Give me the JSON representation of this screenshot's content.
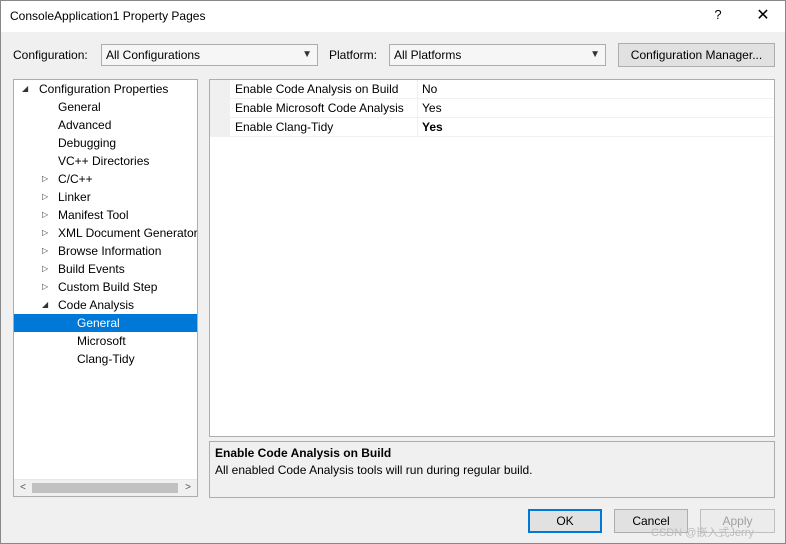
{
  "window": {
    "title": "ConsoleApplication1 Property Pages",
    "help": "?",
    "close": "✕"
  },
  "toolbar": {
    "configuration_label": "Configuration:",
    "configuration_value": "All Configurations",
    "platform_label": "Platform:",
    "platform_value": "All Platforms",
    "config_manager_label": "Configuration Manager..."
  },
  "tree": {
    "items": [
      {
        "label": "Configuration Properties",
        "expander": "◢"
      },
      {
        "label": "General"
      },
      {
        "label": "Advanced"
      },
      {
        "label": "Debugging"
      },
      {
        "label": "VC++ Directories"
      },
      {
        "label": "C/C++",
        "expander": "▷"
      },
      {
        "label": "Linker",
        "expander": "▷"
      },
      {
        "label": "Manifest Tool",
        "expander": "▷"
      },
      {
        "label": "XML Document Generator",
        "expander": "▷"
      },
      {
        "label": "Browse Information",
        "expander": "▷"
      },
      {
        "label": "Build Events",
        "expander": "▷"
      },
      {
        "label": "Custom Build Step",
        "expander": "▷"
      },
      {
        "label": "Code Analysis",
        "expander": "◢"
      },
      {
        "label": "General",
        "selected": true
      },
      {
        "label": "Microsoft"
      },
      {
        "label": "Clang-Tidy"
      }
    ],
    "scroll_left": "<",
    "scroll_right": ">"
  },
  "properties": [
    {
      "name": "Enable Code Analysis on Build",
      "value": "No"
    },
    {
      "name": "Enable Microsoft Code Analysis",
      "value": "Yes"
    },
    {
      "name": "Enable Clang-Tidy",
      "value": "Yes"
    }
  ],
  "description": {
    "title": "Enable Code Analysis on Build",
    "text": "All enabled Code Analysis tools will run during regular build."
  },
  "buttons": {
    "ok": "OK",
    "cancel": "Cancel",
    "apply": "Apply"
  },
  "watermark": "CSDN @嵌入式Jerry",
  "colors": {
    "selection": "#0078d7",
    "default_button_border": "#0078d7"
  }
}
